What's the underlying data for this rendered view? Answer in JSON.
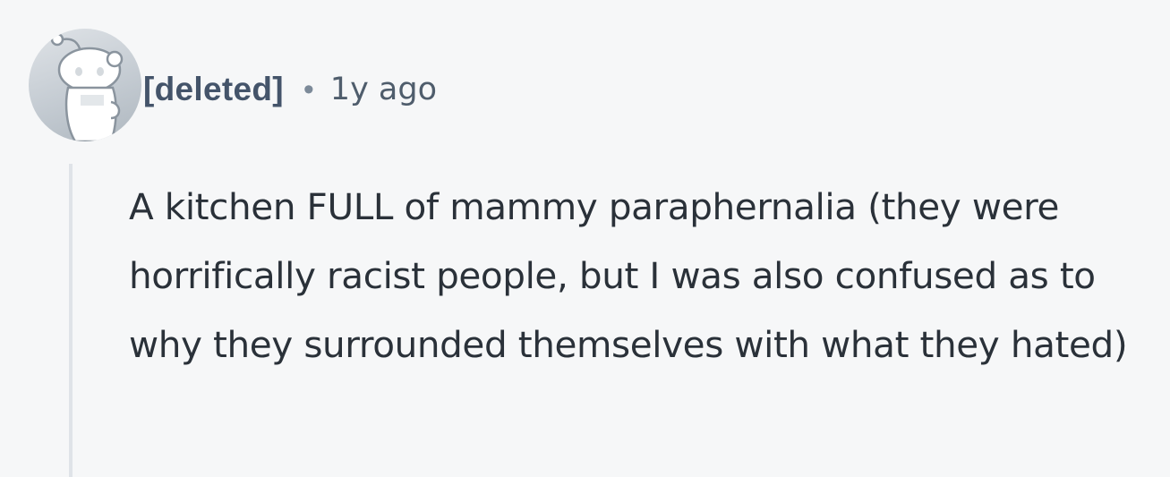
{
  "comment": {
    "avatar": {
      "icon": "reddit-snoo-icon"
    },
    "author": "[deleted]",
    "separator": "•",
    "timestamp": "1y ago",
    "body": "A kitchen FULL of mammy paraphernalia (they were horrifically racist people, but I was also confused as to why they surrounded themselves with what they hated)"
  },
  "colors": {
    "background": "#f6f7f8",
    "author": "#44546a",
    "body_text": "#2a3139",
    "thread_line": "#dfe3e8"
  }
}
